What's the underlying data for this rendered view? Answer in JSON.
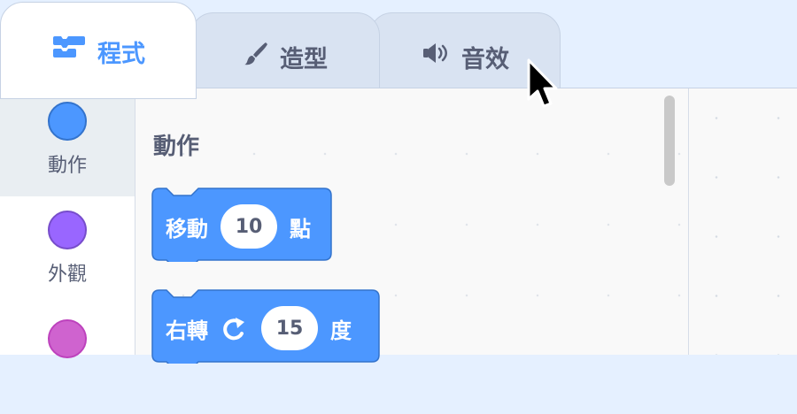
{
  "tabs": {
    "code": {
      "label": "程式",
      "icon": "code-blocks-icon",
      "active": true
    },
    "costumes": {
      "label": "造型",
      "icon": "paintbrush-icon",
      "active": false
    },
    "sounds": {
      "label": "音效",
      "icon": "speaker-icon",
      "active": false
    }
  },
  "categories": [
    {
      "label": "動作",
      "color": "#4c97ff",
      "border": "#3373cc",
      "selected": true
    },
    {
      "label": "外觀",
      "color": "#9966ff",
      "border": "#774dcb",
      "selected": false
    },
    {
      "label": "",
      "color": "#cf63cf",
      "border": "#bd42bd",
      "selected": false
    }
  ],
  "palette": {
    "title": "動作",
    "blocks": {
      "move": {
        "text": "移動",
        "value": "10",
        "unit": "點"
      },
      "turn_right": {
        "text": "右轉",
        "icon": "rotate-clockwise-icon",
        "value": "15",
        "unit": "度"
      }
    }
  },
  "colors": {
    "motion_block": "#4c97ff",
    "motion_block_border": "#3373cc",
    "active_tab_text": "#4c97ff",
    "tab_text": "#575e75"
  }
}
